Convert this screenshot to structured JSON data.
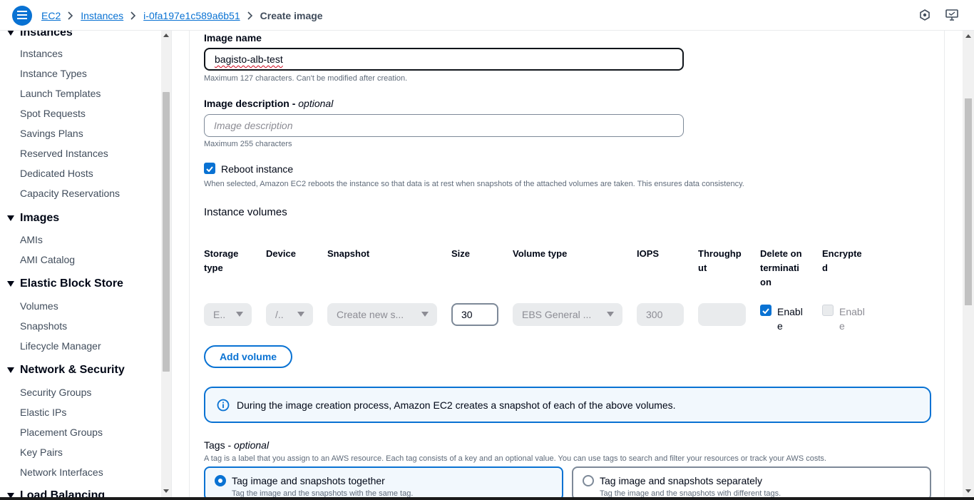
{
  "breadcrumbs": {
    "items": [
      "EC2",
      "Instances",
      "i-0fa197e1c589a6b51"
    ],
    "current": "Create image"
  },
  "sidebar": {
    "partial_top": "Instances",
    "sections": [
      {
        "title": "Images",
        "items": [
          "AMIs",
          "AMI Catalog"
        ]
      },
      {
        "title": "Elastic Block Store",
        "items": [
          "Volumes",
          "Snapshots",
          "Lifecycle Manager"
        ]
      },
      {
        "title": "Network & Security",
        "items": [
          "Security Groups",
          "Elastic IPs",
          "Placement Groups",
          "Key Pairs",
          "Network Interfaces"
        ]
      },
      {
        "title": "Load Balancing",
        "items": []
      }
    ],
    "instances_items": [
      "Instances",
      "Instance Types",
      "Launch Templates",
      "Spot Requests",
      "Savings Plans",
      "Reserved Instances",
      "Dedicated Hosts",
      "Capacity Reservations"
    ]
  },
  "form": {
    "image_name": {
      "label": "Image name",
      "value": "bagisto-alb-test",
      "hint": "Maximum 127 characters. Can't be modified after creation."
    },
    "image_description": {
      "label": "Image description",
      "label_suffix": "optional",
      "placeholder": "Image description",
      "hint": "Maximum 255 characters"
    },
    "reboot": {
      "label": "Reboot instance",
      "checked": true,
      "hint": "When selected, Amazon EC2 reboots the instance so that data is at rest when snapshots of the attached volumes are taken. This ensures data consistency."
    }
  },
  "volumes": {
    "heading": "Instance volumes",
    "columns": [
      {
        "line1": "Storage",
        "line2": "type",
        "line3": ""
      },
      {
        "line1": "Device",
        "line2": "",
        "line3": ""
      },
      {
        "line1": "Snapshot",
        "line2": "",
        "line3": ""
      },
      {
        "line1": "Size",
        "line2": "",
        "line3": ""
      },
      {
        "line1": "Volume type",
        "line2": "",
        "line3": ""
      },
      {
        "line1": "IOPS",
        "line2": "",
        "line3": ""
      },
      {
        "line1": "Throughp",
        "line2": "ut",
        "line3": ""
      },
      {
        "line1": "Delete on",
        "line2": "terminati",
        "line3": "on"
      },
      {
        "line1": "Encrypte",
        "line2": "d",
        "line3": ""
      }
    ],
    "row": {
      "storage_type": "E..",
      "device": "/..",
      "snapshot": "Create new s...",
      "size": "30",
      "volume_type": "EBS General ...",
      "iops": "300",
      "throughput": "",
      "delete_on_termination": {
        "label1": "Enabl",
        "label2": "e",
        "checked": true
      },
      "encrypted": {
        "label1": "Enabl",
        "label2": "e",
        "checked": false
      }
    },
    "add_volume": "Add volume"
  },
  "info": {
    "text": "During the image creation process, Amazon EC2 creates a snapshot of each of the above volumes."
  },
  "tags": {
    "label": "Tags",
    "label_suffix": "optional",
    "hint": "A tag is a label that you assign to an AWS resource. Each tag consists of a key and an optional value. You can use tags to search and filter your resources or track your AWS costs.",
    "options": [
      {
        "title": "Tag image and snapshots together",
        "desc": "Tag the image and the snapshots with the same tag.",
        "selected": true
      },
      {
        "title": "Tag image and snapshots separately",
        "desc": "Tag the image and the snapshots with different tags.",
        "selected": false
      }
    ]
  },
  "colors": {
    "accent": "#0972d3",
    "text": "#000716",
    "muted": "#5f6b7a"
  }
}
